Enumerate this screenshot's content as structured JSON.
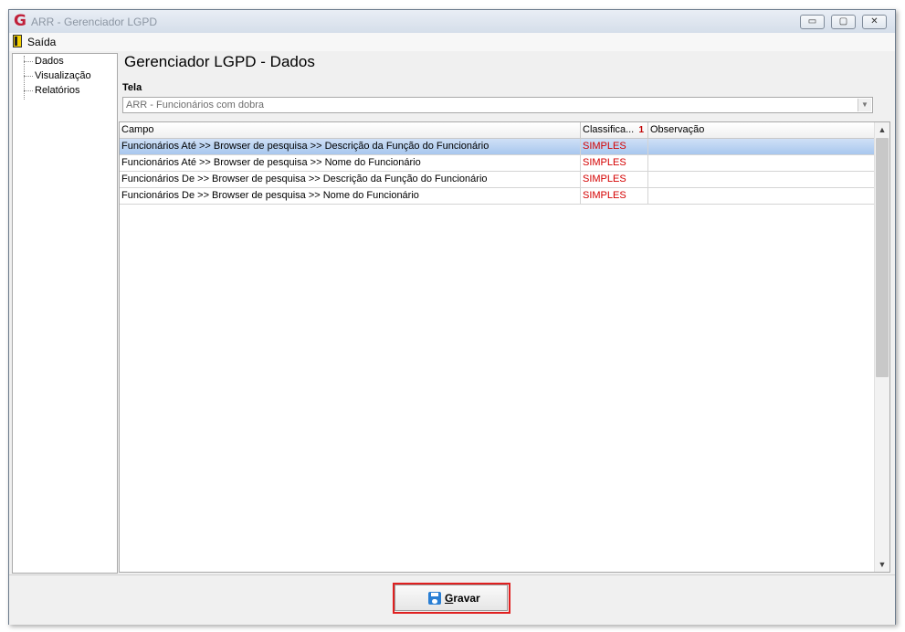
{
  "window": {
    "title": "ARR - Gerenciador LGPD",
    "controls": {
      "minimize": "▭",
      "maximize": "▢",
      "close": "✕"
    }
  },
  "app_icon_glyph": "G",
  "menu": {
    "exit_label": "Saída"
  },
  "nav": {
    "items": [
      "Dados",
      "Visualização",
      "Relatórios"
    ]
  },
  "main": {
    "title": "Gerenciador LGPD - Dados",
    "tela_label": "Tela",
    "tela_value": "ARR - Funcionários com dobra"
  },
  "table": {
    "columns": [
      "Campo",
      "Classifica...",
      "Observação"
    ],
    "sort_indicator": "1",
    "rows": [
      {
        "campo": "Funcionários Até >> Browser de pesquisa >> Descrição da Função do Funcionário",
        "classificacao": "SIMPLES",
        "observacao": ""
      },
      {
        "campo": "Funcionários Até >> Browser de pesquisa >> Nome do Funcionário",
        "classificacao": "SIMPLES",
        "observacao": ""
      },
      {
        "campo": "Funcionários De >> Browser de pesquisa >> Descrição da Função do Funcionário",
        "classificacao": "SIMPLES",
        "observacao": ""
      },
      {
        "campo": "Funcionários De >> Browser de pesquisa >> Nome do Funcionário",
        "classificacao": "SIMPLES",
        "observacao": ""
      }
    ],
    "selected_row": 0
  },
  "footer": {
    "save_first_letter": "G",
    "save_rest": "ravar"
  },
  "colors": {
    "classification": "#d40000",
    "highlight": "#e02020",
    "selection": "#a8c7ee"
  }
}
